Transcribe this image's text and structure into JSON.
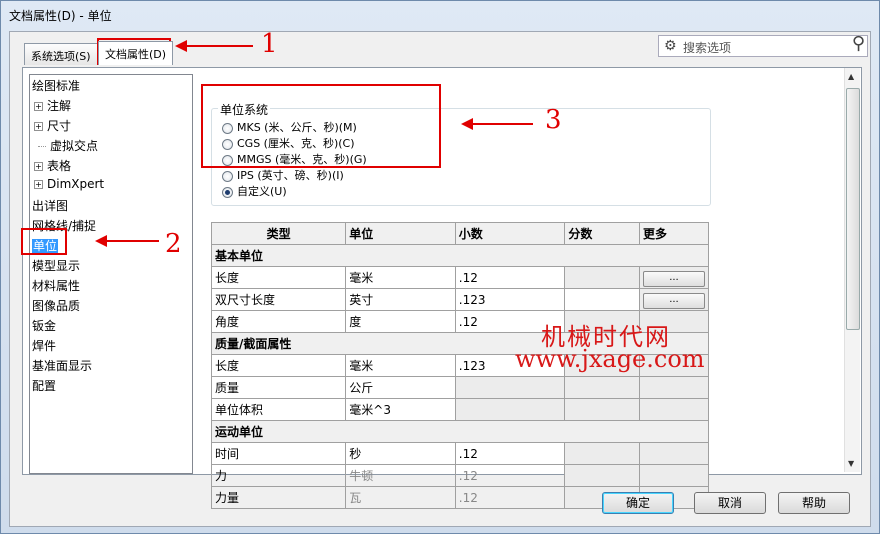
{
  "window": {
    "title": "文档属性(D) - 单位"
  },
  "tabs": [
    {
      "label": "系统选项(S)"
    },
    {
      "label": "文档属性(D)"
    }
  ],
  "search": {
    "placeholder": "搜索选项"
  },
  "tree": {
    "items": [
      {
        "label": "绘图标准"
      },
      {
        "label": "注解"
      },
      {
        "label": "尺寸"
      },
      {
        "label": "虚拟交点"
      },
      {
        "label": "表格"
      },
      {
        "label": "DimXpert"
      },
      {
        "label": "出详图"
      },
      {
        "label": "网格线/捕捉"
      },
      {
        "label": "单位"
      },
      {
        "label": "模型显示"
      },
      {
        "label": "材料属性"
      },
      {
        "label": "图像品质"
      },
      {
        "label": "钣金"
      },
      {
        "label": "焊件"
      },
      {
        "label": "基准面显示"
      },
      {
        "label": "配置"
      }
    ]
  },
  "unit_system": {
    "label": "单位系统",
    "options": [
      {
        "label": "MKS (米、公斤、秒)(M)",
        "selected": false
      },
      {
        "label": "CGS (厘米、克、秒)(C)",
        "selected": false
      },
      {
        "label": "MMGS (毫米、克、秒)(G)",
        "selected": false
      },
      {
        "label": "IPS (英寸、磅、秒)(I)",
        "selected": false
      },
      {
        "label": "自定义(U)",
        "selected": true
      }
    ]
  },
  "table": {
    "headers": {
      "type": "类型",
      "unit": "单位",
      "decimals": "小数",
      "fractions": "分数",
      "more": "更多"
    },
    "sections": {
      "basic": "基本单位",
      "mass": "质量/截面属性",
      "motion": "运动单位"
    },
    "rows": {
      "length": {
        "type": "长度",
        "unit": "毫米",
        "decimals": ".12",
        "more": "..."
      },
      "dual": {
        "type": "双尺寸长度",
        "unit": "英寸",
        "decimals": ".123",
        "more": "..."
      },
      "angle": {
        "type": "角度",
        "unit": "度",
        "decimals": ".12"
      },
      "m_length": {
        "type": "长度",
        "unit": "毫米",
        "decimals": ".123"
      },
      "mass": {
        "type": "质量",
        "unit": "公斤"
      },
      "volume": {
        "type": "单位体积",
        "unit": "毫米^3"
      },
      "time": {
        "type": "时间",
        "unit": "秒",
        "decimals": ".12"
      },
      "force": {
        "type": "力",
        "unit": "牛顿",
        "decimals": ".12"
      },
      "power": {
        "type": "力量",
        "unit": "瓦",
        "decimals": ".12"
      }
    }
  },
  "buttons": {
    "ok": "确定",
    "cancel": "取消",
    "help": "帮助"
  },
  "annotations": {
    "n1": "1",
    "n2": "2",
    "n3": "3"
  },
  "watermark": {
    "line1": "机械时代网",
    "line2": "www.jxage.com"
  },
  "colors": {
    "annotation": "#e00000",
    "selection": "#3399ff",
    "watermark": "#d81818"
  }
}
